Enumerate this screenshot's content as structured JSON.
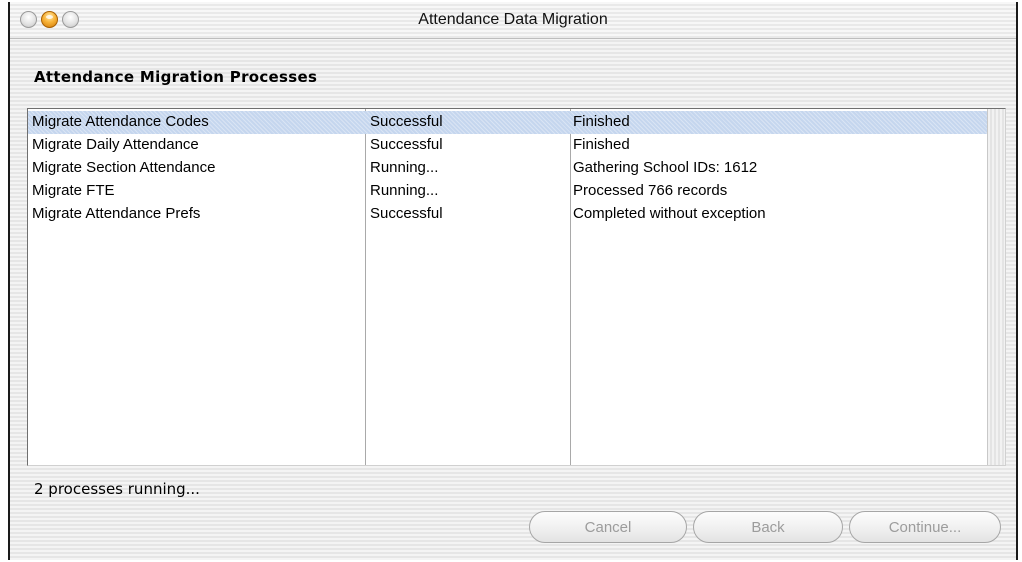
{
  "window": {
    "title": "Attendance Data Migration"
  },
  "section_heading": "Attendance Migration Processes",
  "table": {
    "rows": [
      {
        "process": "Migrate Attendance Codes",
        "status": "Successful",
        "details": "Finished",
        "selected": true
      },
      {
        "process": "Migrate Daily Attendance",
        "status": "Successful",
        "details": "Finished",
        "selected": false
      },
      {
        "process": "Migrate Section Attendance",
        "status": "Running...",
        "details": "Gathering School IDs: 1612",
        "selected": false
      },
      {
        "process": "Migrate FTE",
        "status": "Running...",
        "details": "Processed 766 records",
        "selected": false
      },
      {
        "process": "Migrate Attendance Prefs",
        "status": "Successful",
        "details": "Completed without exception",
        "selected": false
      }
    ]
  },
  "status_text": "2 processes running...",
  "buttons": {
    "cancel": "Cancel",
    "back": "Back",
    "continue": "Continue..."
  },
  "colors": {
    "selection": "#c5d6ee",
    "minimize_button": "#f8b43a",
    "disabled_button_text": "#9c9c9c"
  }
}
